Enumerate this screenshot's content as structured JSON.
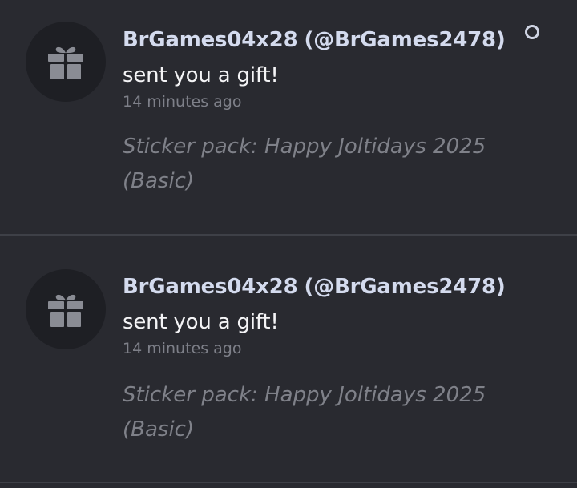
{
  "notifications": [
    {
      "sender_display": "BrGames04x28",
      "sender_username": "(@BrGames2478)",
      "action": "sent you a gift!",
      "time": "14 minutes ago",
      "detail": "Sticker pack: Happy Joltidays 2025 (Basic)",
      "unread": true,
      "icon": "gift-icon"
    },
    {
      "sender_display": "BrGames04x28",
      "sender_username": "(@BrGames2478)",
      "action": "sent you a gift!",
      "time": "14 minutes ago",
      "detail": "Sticker pack: Happy Joltidays 2025 (Basic)",
      "unread": false,
      "icon": "gift-icon"
    }
  ],
  "colors": {
    "background": "#292a30",
    "sender": "#d4dbee",
    "muted": "#7f8189",
    "divider": "#3e4047"
  }
}
